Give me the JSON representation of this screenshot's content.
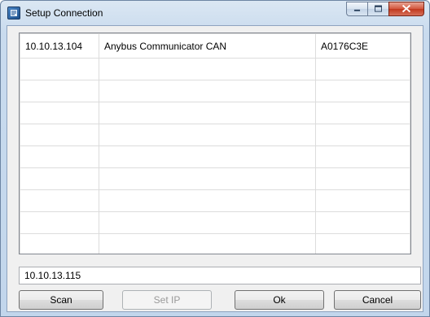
{
  "window": {
    "title": "Setup Connection"
  },
  "devices": {
    "rows": [
      [
        "10.10.13.104",
        "Anybus Communicator CAN",
        "A0176C3E"
      ],
      [
        "",
        "",
        ""
      ],
      [
        "",
        "",
        ""
      ],
      [
        "",
        "",
        ""
      ],
      [
        "",
        "",
        ""
      ],
      [
        "",
        "",
        ""
      ],
      [
        "",
        "",
        ""
      ],
      [
        "",
        "",
        ""
      ],
      [
        "",
        "",
        ""
      ],
      [
        "",
        "",
        ""
      ]
    ]
  },
  "ip_field": {
    "value": "10.10.13.115"
  },
  "buttons": {
    "scan": "Scan",
    "set_ip": "Set IP",
    "ok": "Ok",
    "cancel": "Cancel"
  }
}
